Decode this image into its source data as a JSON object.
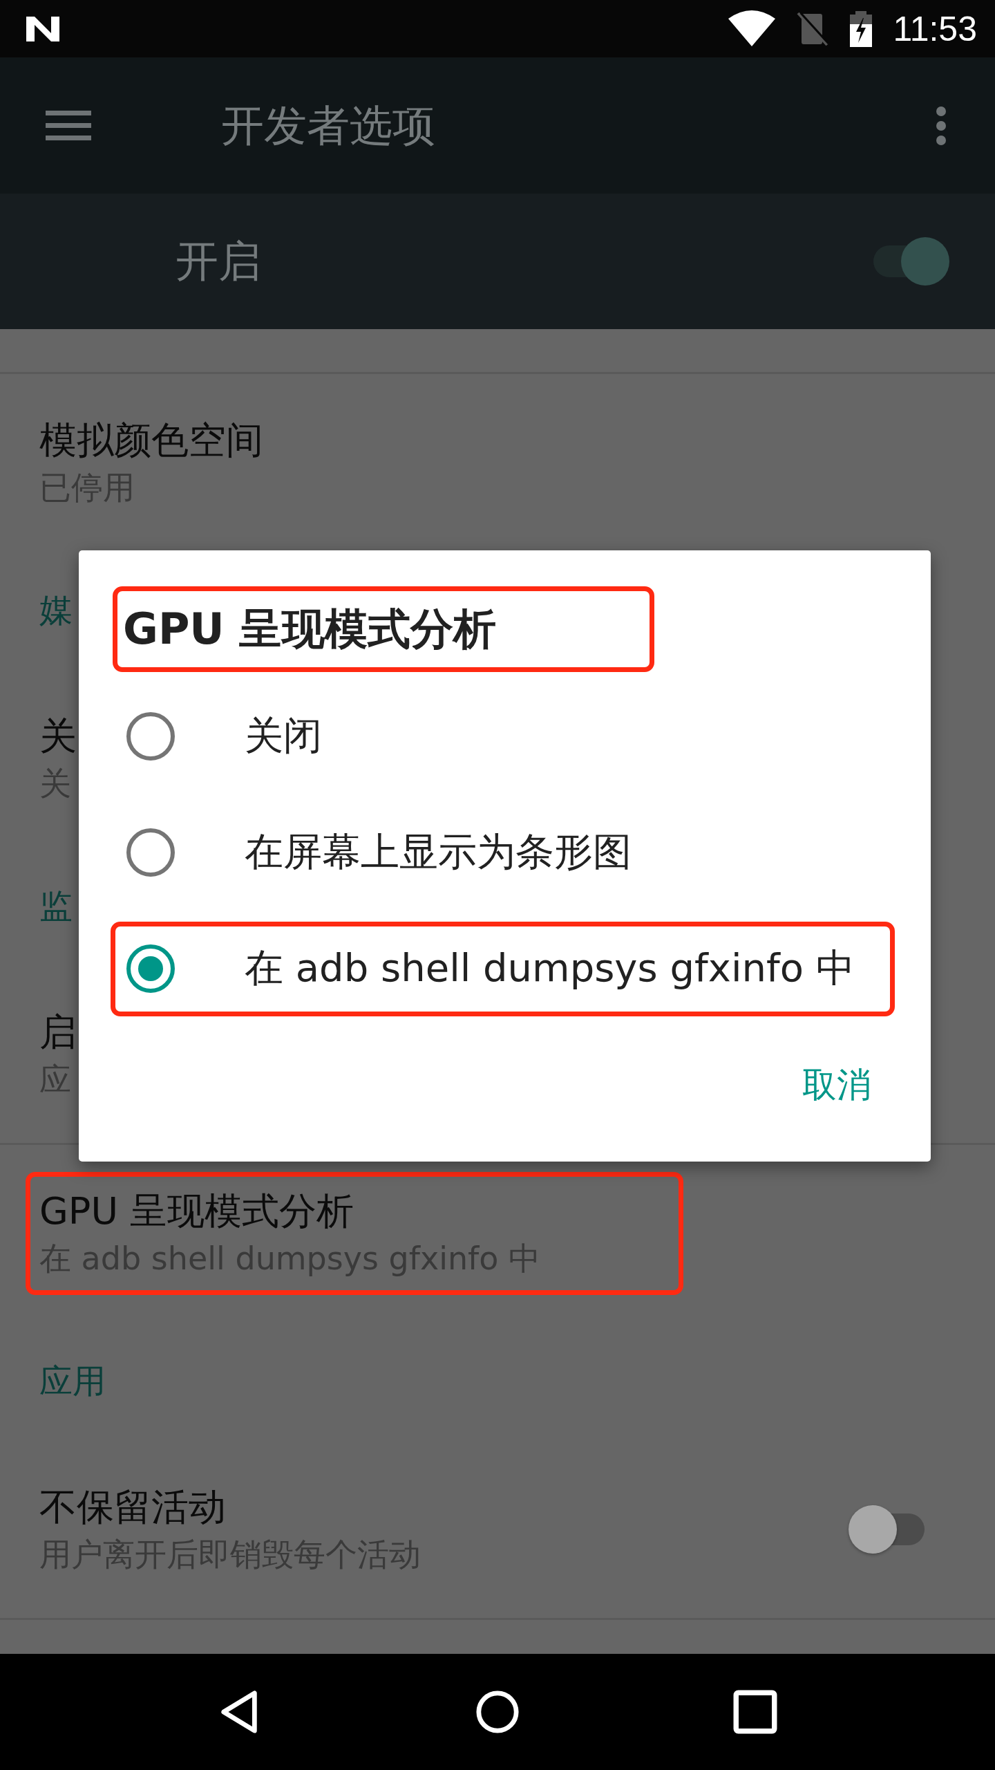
{
  "status_bar": {
    "time": "11:53"
  },
  "toolbar": {
    "title": "开发者选项"
  },
  "master_switch": {
    "label": "开启",
    "on": true
  },
  "settings": [
    {
      "kind": "item",
      "title": "模拟颜色空间",
      "subtitle": "已停用",
      "highlighted": false,
      "divider_above": true
    },
    {
      "kind": "header",
      "title": "媒"
    },
    {
      "kind": "item",
      "title": "关",
      "subtitle": "关",
      "highlighted": false,
      "divider_above": false
    },
    {
      "kind": "header",
      "title": "监"
    },
    {
      "kind": "item",
      "title": "启",
      "subtitle": "应",
      "highlighted": false,
      "divider_above": false
    },
    {
      "kind": "item",
      "title": "GPU 呈现模式分析",
      "subtitle": "在 adb shell dumpsys gfxinfo 中",
      "highlighted": true,
      "divider_above": true
    },
    {
      "kind": "header",
      "title": "应用"
    },
    {
      "kind": "switch",
      "title": "不保留活动",
      "subtitle": "用户离开后即销毁每个活动",
      "on": false,
      "highlighted": false,
      "divider_above": false
    }
  ],
  "dialog": {
    "title": "GPU 呈现模式分析",
    "title_highlighted": true,
    "options": [
      {
        "label": "关闭",
        "selected": false,
        "highlighted": false
      },
      {
        "label": "在屏幕上显示为条形图",
        "selected": false,
        "highlighted": false
      },
      {
        "label": "在 adb shell dumpsys gfxinfo 中",
        "selected": true,
        "highlighted": true
      }
    ],
    "button": "取消"
  }
}
